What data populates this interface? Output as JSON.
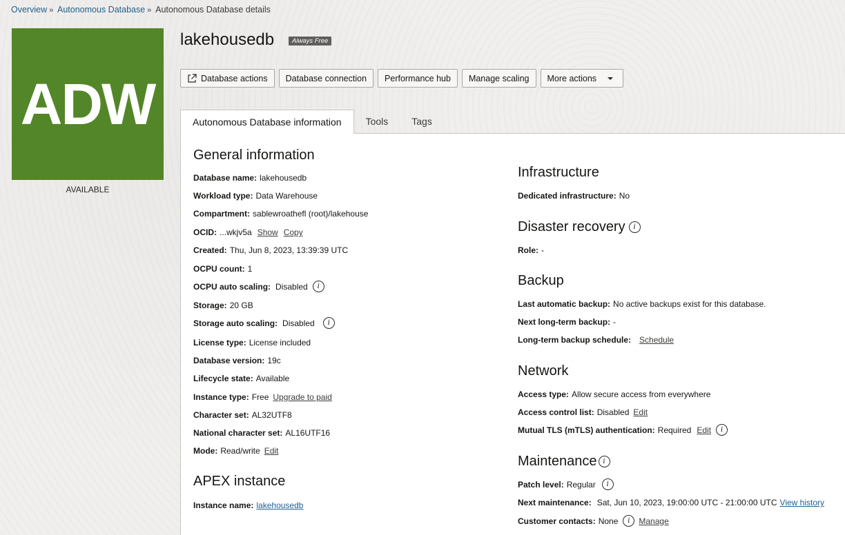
{
  "breadcrumb": {
    "items": [
      "Overview",
      "Autonomous Database"
    ],
    "current": "Autonomous Database details",
    "separator": "»"
  },
  "logo": {
    "text": "ADW",
    "status": "AVAILABLE",
    "color": "#538628"
  },
  "title": "lakehousedb",
  "badge": "Always Free",
  "actions": [
    "Database actions",
    "Database connection",
    "Performance hub",
    "Manage scaling",
    "More actions"
  ],
  "tabs": [
    "Autonomous Database information",
    "Tools",
    "Tags"
  ],
  "general": {
    "heading": "General information",
    "db_name": {
      "label": "Database name:",
      "value": "lakehousedb"
    },
    "workload": {
      "label": "Workload type:",
      "value": "Data Warehouse"
    },
    "compartment": {
      "label": "Compartment:",
      "value": "sablewroathefl (root)/lakehouse"
    },
    "ocid": {
      "label": "OCID:",
      "value": "...wkjv5a",
      "show": "Show",
      "copy": "Copy"
    },
    "created": {
      "label": "Created:",
      "value": "Thu, Jun 8, 2023, 13:39:39 UTC"
    },
    "ocpu": {
      "label": "OCPU count:",
      "value": "1"
    },
    "ocpu_scaling": {
      "label": "OCPU auto scaling:",
      "value": "Disabled"
    },
    "storage": {
      "label": "Storage:",
      "value": "20 GB"
    },
    "storage_scaling": {
      "label": "Storage auto scaling:",
      "value": "Disabled"
    },
    "license": {
      "label": "License type:",
      "value": "License included"
    },
    "version": {
      "label": "Database version:",
      "value": "19c"
    },
    "lifecycle": {
      "label": "Lifecycle state:",
      "value": "Available"
    },
    "instance_type": {
      "label": "Instance type:",
      "value": "Free",
      "link": "Upgrade to paid"
    },
    "charset": {
      "label": "Character set:",
      "value": "AL32UTF8"
    },
    "ncharset": {
      "label": "National character set:",
      "value": "AL16UTF16"
    },
    "mode": {
      "label": "Mode:",
      "value": "Read/write",
      "link": "Edit"
    }
  },
  "apex": {
    "heading": "APEX instance",
    "instance": {
      "label": "Instance name:",
      "value": "lakehousedb"
    }
  },
  "infrastructure": {
    "heading": "Infrastructure",
    "dedicated": {
      "label": "Dedicated infrastructure:",
      "value": "No"
    }
  },
  "dr": {
    "heading": "Disaster recovery",
    "role": {
      "label": "Role:",
      "value": "-"
    }
  },
  "backup": {
    "heading": "Backup",
    "last": {
      "label": "Last automatic backup:",
      "value": "No active backups exist for this database."
    },
    "next": {
      "label": "Next long-term backup:",
      "value": "-"
    },
    "schedule": {
      "label": "Long-term backup schedule:",
      "link": "Schedule"
    }
  },
  "network": {
    "heading": "Network",
    "access": {
      "label": "Access type:",
      "value": "Allow secure access from everywhere"
    },
    "acl": {
      "label": "Access control list:",
      "value": "Disabled",
      "link": "Edit"
    },
    "mtls": {
      "label": "Mutual TLS (mTLS) authentication:",
      "value": "Required",
      "link": "Edit"
    }
  },
  "maintenance": {
    "heading": "Maintenance",
    "patch": {
      "label": "Patch level:",
      "value": "Regular"
    },
    "next": {
      "label": "Next maintenance:",
      "value": "Sat, Jun 10, 2023, 19:00:00 UTC - 21:00:00 UTC",
      "link": "View history"
    },
    "contacts": {
      "label": "Customer contacts:",
      "value": "None",
      "link": "Manage"
    }
  },
  "info_glyph": "i"
}
